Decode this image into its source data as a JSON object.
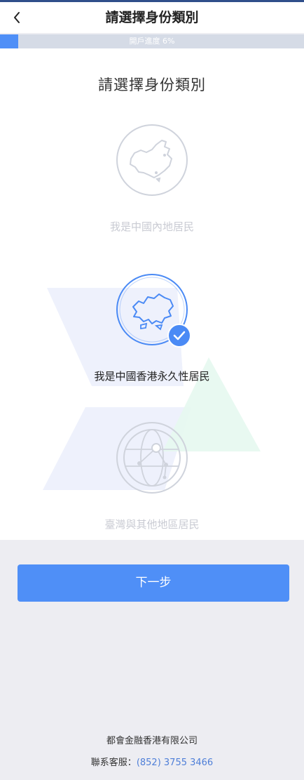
{
  "header": {
    "back_icon": "chevron-left-icon",
    "title": "請選擇身份類別"
  },
  "progress": {
    "label": "開戶進度 6%",
    "percent": 6,
    "fill_color": "#4f8ff7",
    "track_color": "#d5dbe6"
  },
  "main": {
    "title": "請選擇身份類別",
    "options": [
      {
        "label": "我是中國內地居民",
        "icon": "china-map-icon",
        "selected": false
      },
      {
        "label": "我是中國香港永久性居民",
        "icon": "hong-kong-map-icon",
        "selected": true
      },
      {
        "label": "臺灣與其他地區居民",
        "icon": "globe-icon",
        "selected": false
      }
    ]
  },
  "next_button": {
    "label": "下一步",
    "color": "#4f8ff7"
  },
  "footer": {
    "company": "都會金融香港有限公司",
    "service_label": "聯系客服：",
    "service_phone": "(852) 3755 3466"
  }
}
